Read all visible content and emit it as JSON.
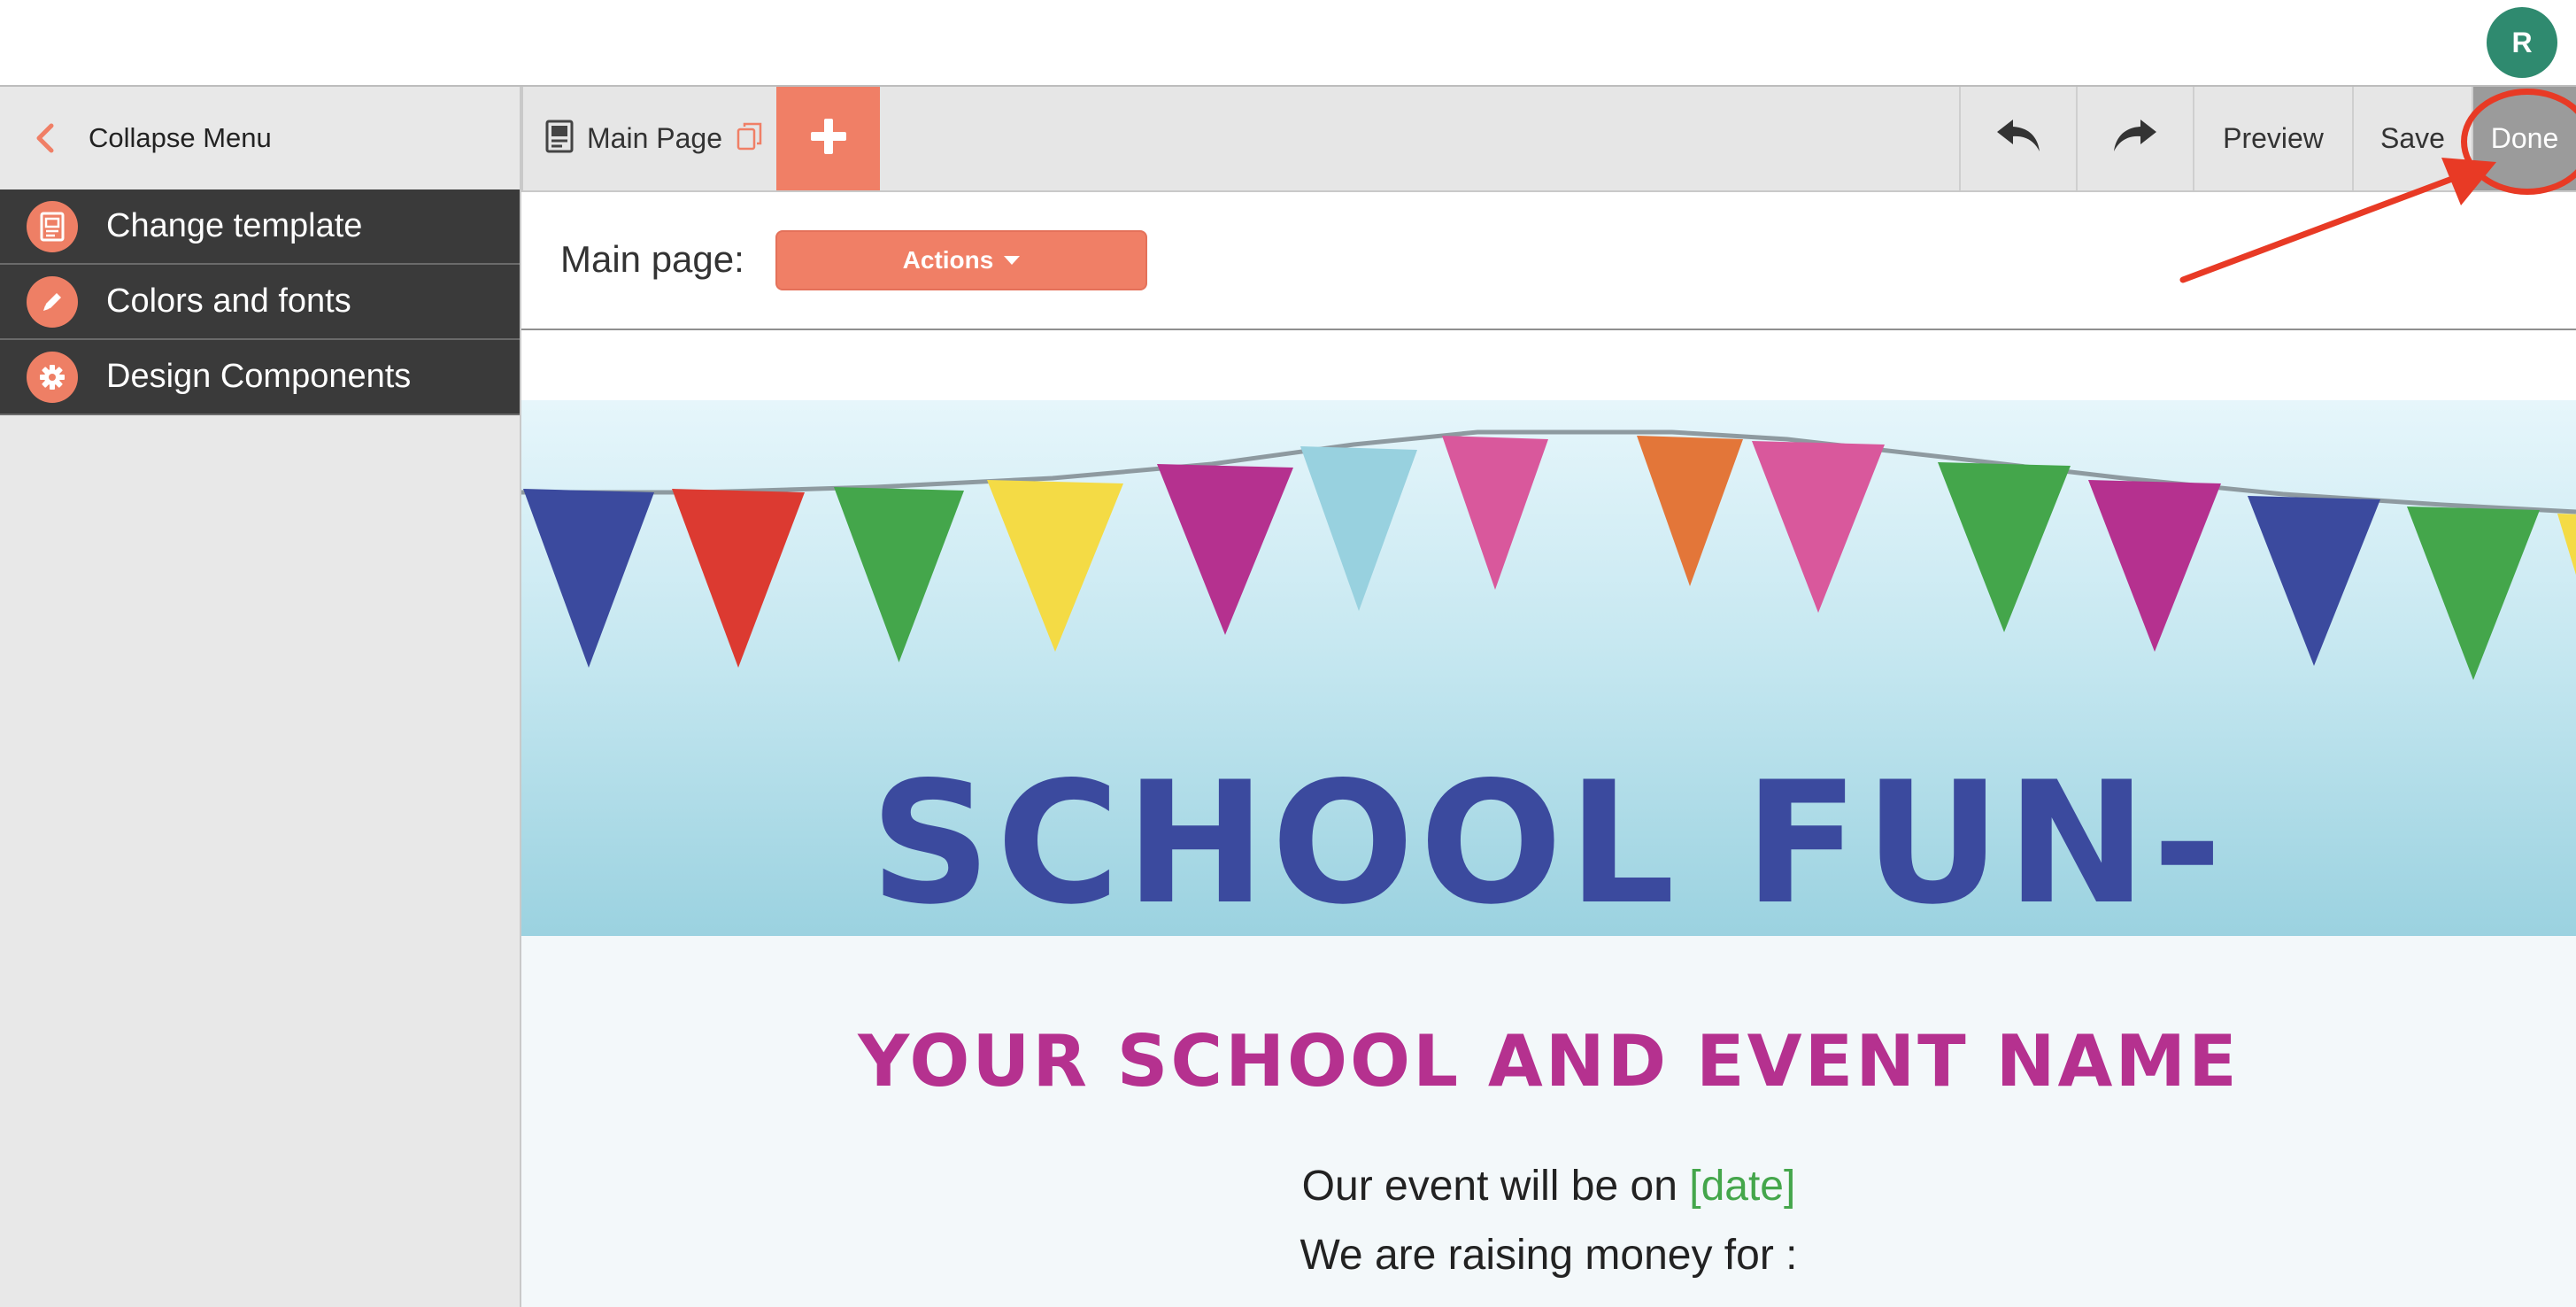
{
  "account": {
    "avatar_initial": "R"
  },
  "sidebar": {
    "collapse_label": "Collapse Menu",
    "items": [
      {
        "label": "Change template",
        "icon": "template-icon"
      },
      {
        "label": "Colors and fonts",
        "icon": "pencil-icon"
      },
      {
        "label": "Design Components",
        "icon": "gear-icon"
      }
    ]
  },
  "toolbar": {
    "page_tab": "Main Page",
    "preview": "Preview",
    "save": "Save",
    "done": "Done"
  },
  "page_header": {
    "label": "Main page:",
    "actions": "Actions"
  },
  "canvas": {
    "banner_title": "SCHOOL FUN-RAISING",
    "event_name": "YOUR SCHOOL AND EVENT NAME",
    "line1_text": "Our event will be on ",
    "line1_date": "[date]",
    "line2_text": "We are raising money for :"
  },
  "colors": {
    "accent": "#f07f66",
    "sidebar_dark": "#3a3a3a",
    "banner_title": "#3b4a9e",
    "event_name": "#b5318f",
    "date": "#44a64b",
    "annotation": "#e83a25"
  }
}
